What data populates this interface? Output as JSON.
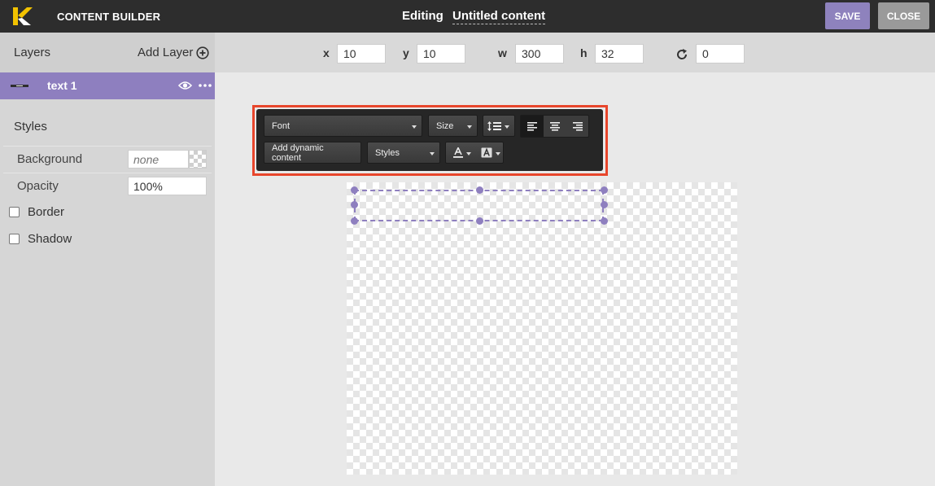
{
  "app": {
    "title": "CONTENT BUILDER",
    "accent": "#8e7fbf",
    "highlight": "#e8462c"
  },
  "header": {
    "editing_label": "Editing",
    "doc_name": "Untitled content",
    "save_label": "SAVE",
    "close_label": "CLOSE"
  },
  "sidebar": {
    "layers_title": "Layers",
    "add_layer_label": "Add Layer",
    "layers": [
      {
        "name": "text 1",
        "visible": true,
        "selected": true
      }
    ],
    "styles_title": "Styles",
    "background": {
      "label": "Background",
      "placeholder": "none"
    },
    "opacity": {
      "label": "Opacity",
      "value": "100%"
    },
    "border": {
      "label": "Border",
      "checked": false
    },
    "shadow": {
      "label": "Shadow",
      "checked": false
    }
  },
  "transform": {
    "x": {
      "label": "x",
      "value": "10"
    },
    "y": {
      "label": "y",
      "value": "10"
    },
    "w": {
      "label": "w",
      "value": "300"
    },
    "h": {
      "label": "h",
      "value": "32"
    },
    "rotation": {
      "icon": "rotate-icon",
      "value": "0"
    }
  },
  "text_toolbar": {
    "font_label": "Font",
    "size_label": "Size",
    "line_height_icon": "line-height-icon",
    "align_options": [
      "align-left",
      "align-center",
      "align-right"
    ],
    "align_selected": "align-left",
    "dynamic_label": "Add dynamic content",
    "styles_label": "Styles",
    "text_color_icon": "text-color-icon",
    "bg_color_icon": "text-background-color-icon"
  }
}
